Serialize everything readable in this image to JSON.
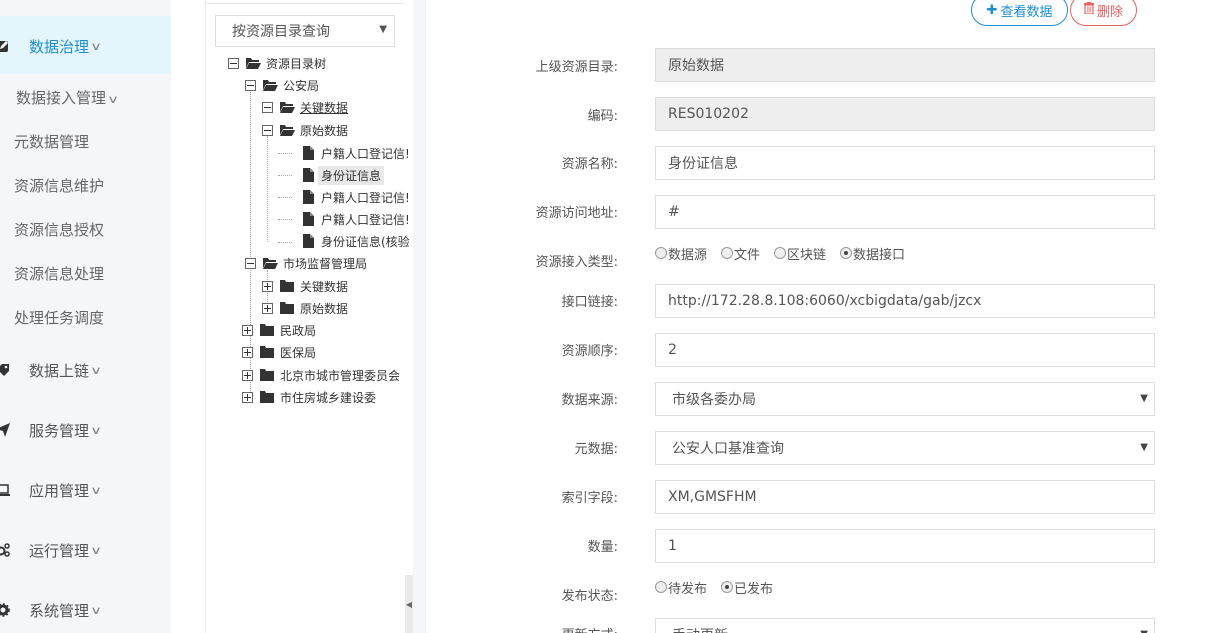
{
  "sidebar": {
    "top_items": [
      {
        "label": "数据治理",
        "icon": "edit-icon"
      },
      {
        "label": "数据上链",
        "icon": "tag-icon"
      },
      {
        "label": "服务管理",
        "icon": "send-icon"
      },
      {
        "label": "应用管理",
        "icon": "laptop-icon"
      },
      {
        "label": "运行管理",
        "icon": "gears-icon"
      },
      {
        "label": "系统管理",
        "icon": "gear-icon"
      }
    ],
    "sub_items": [
      {
        "label": "数据接入管理"
      },
      {
        "label": "元数据管理"
      },
      {
        "label": "资源信息维护"
      },
      {
        "label": "资源信息授权"
      },
      {
        "label": "资源信息处理"
      },
      {
        "label": "处理任务调度"
      }
    ]
  },
  "tree": {
    "query_mode": "按资源目录查询",
    "nodes": [
      {
        "label": "资源目录树"
      },
      {
        "label": "公安局"
      },
      {
        "label": "关键数据"
      },
      {
        "label": "原始数据"
      },
      {
        "label": "户籍人口登记信!"
      },
      {
        "label": "身份证信息"
      },
      {
        "label": "户籍人口登记信!"
      },
      {
        "label": "户籍人口登记信!"
      },
      {
        "label": "身份证信息(核验"
      },
      {
        "label": "市场监督管理局"
      },
      {
        "label": "关键数据"
      },
      {
        "label": "原始数据"
      },
      {
        "label": "民政局"
      },
      {
        "label": "医保局"
      },
      {
        "label": "北京市城市管理委员会"
      },
      {
        "label": "市住房城乡建设委"
      }
    ]
  },
  "actions": {
    "view_label": "查看数据",
    "delete_label": "删除"
  },
  "form": {
    "parent_catalog": {
      "label": "上级资源目录:",
      "value": "原始数据"
    },
    "code": {
      "label": "编码:",
      "value": "RES010202"
    },
    "resource_name": {
      "label": "资源名称:",
      "value": "身份证信息"
    },
    "access_url": {
      "label": "资源访问地址:",
      "value": "#"
    },
    "access_type": {
      "label": "资源接入类型:",
      "options": [
        "数据源",
        "文件",
        "区块链",
        "数据接口"
      ],
      "selected": "数据接口"
    },
    "interface_link": {
      "label": "接口链接:",
      "value": "http://172.28.8.108:6060/xcbigdata/gab/jzcx"
    },
    "order": {
      "label": "资源顺序:",
      "value": "2"
    },
    "data_source": {
      "label": "数据来源:",
      "value": "市级各委办局"
    },
    "metadata": {
      "label": "元数据:",
      "value": "公安人口基准查询"
    },
    "index_fields": {
      "label": "索引字段:",
      "value": "XM,GMSFHM"
    },
    "quantity": {
      "label": "数量:",
      "value": "1"
    },
    "publish_status": {
      "label": "发布状态:",
      "options": [
        "待发布",
        "已发布"
      ],
      "selected": "已发布"
    },
    "update_mode": {
      "label": "更新方式:",
      "value": "手动更新"
    }
  },
  "colors": {
    "accent": "#1b90d0",
    "danger": "#e86060",
    "active_bg": "#e5f5fc"
  }
}
